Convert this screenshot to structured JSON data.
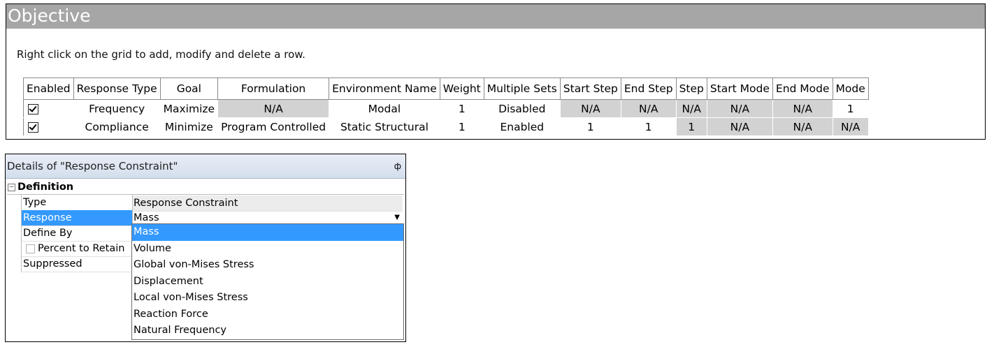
{
  "objective": {
    "title": "Objective",
    "instructions": "Right click on the grid to add, modify and delete a row.",
    "columns": [
      "Enabled",
      "Response Type",
      "Goal",
      "Formulation",
      "Environment Name",
      "Weight",
      "Multiple Sets",
      "Start Step",
      "End Step",
      "Step",
      "Start Mode",
      "End Mode",
      "Mode"
    ],
    "rows": [
      {
        "enabled": true,
        "response_type": "Frequency",
        "goal": "Maximize",
        "formulation": "N/A",
        "environment_name": "Modal",
        "weight": "1",
        "multiple_sets": "Disabled",
        "start_step": "N/A",
        "end_step": "N/A",
        "step": "N/A",
        "start_mode": "N/A",
        "end_mode": "N/A",
        "mode": "1"
      },
      {
        "enabled": true,
        "response_type": "Compliance",
        "goal": "Minimize",
        "formulation": "Program Controlled",
        "environment_name": "Static Structural",
        "weight": "1",
        "multiple_sets": "Enabled",
        "start_step": "1",
        "end_step": "1",
        "step": "1",
        "start_mode": "N/A",
        "end_mode": "N/A",
        "mode": "N/A"
      }
    ]
  },
  "details": {
    "title": "Details of \"Response Constraint\"",
    "pin_icon": "ф",
    "section": "Definition",
    "collapse_symbol": "−",
    "rows": [
      {
        "label": "Type",
        "value": "Response Constraint"
      },
      {
        "label": "Response",
        "value": "Mass"
      },
      {
        "label": "Define By",
        "value": ""
      },
      {
        "label": "Percent to Retain",
        "value": ""
      },
      {
        "label": "Suppressed",
        "value": ""
      }
    ],
    "dropdown_arrow": "▼",
    "dropdown_options": [
      "Mass",
      "Volume",
      "Global von-Mises Stress",
      "Displacement",
      "Local von-Mises Stress",
      "Reaction Force",
      "Natural Frequency"
    ],
    "dropdown_selected": "Mass"
  },
  "colors": {
    "header_gray": "#a6a6a6",
    "cell_gray": "#d2d2d2",
    "selection_blue": "#3399ff"
  }
}
